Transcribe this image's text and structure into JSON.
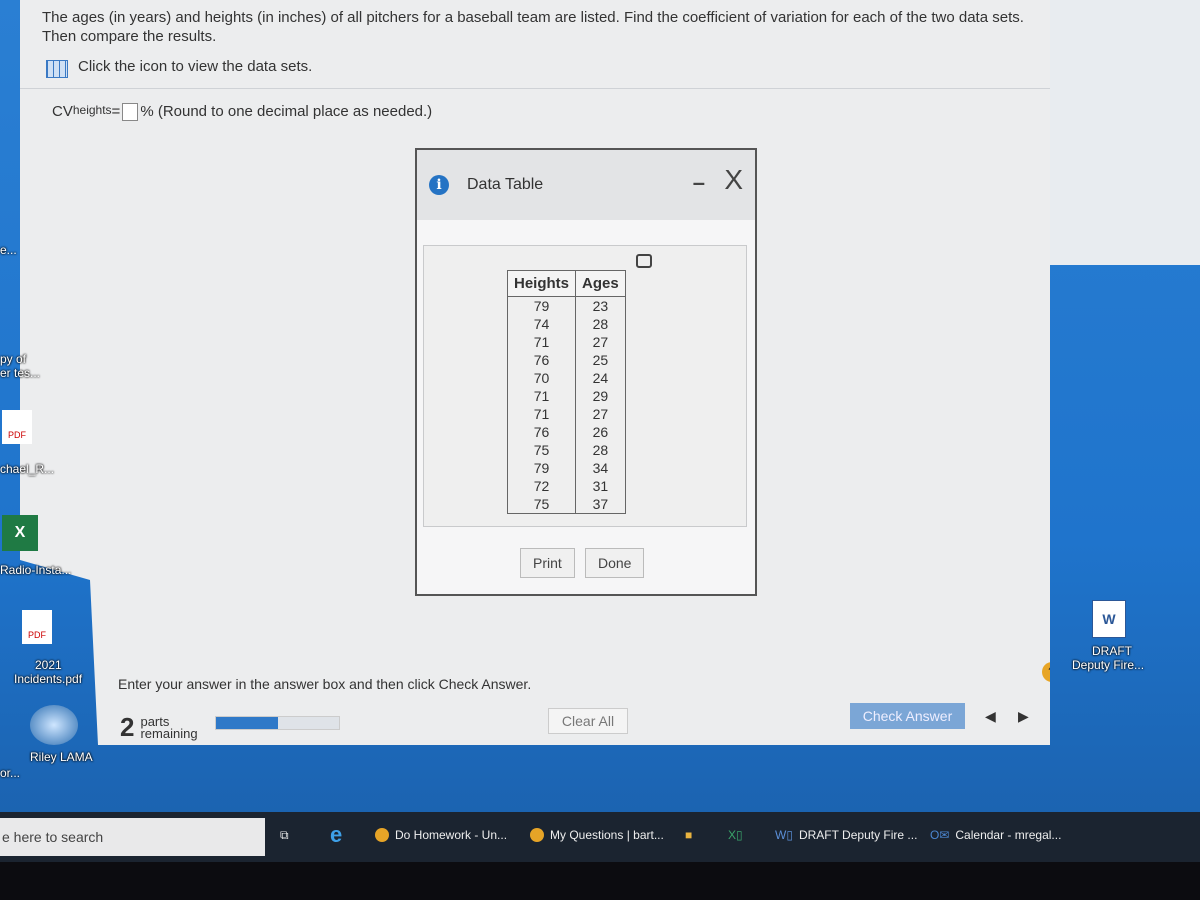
{
  "question": {
    "text": "The ages (in years) and heights (in inches) of all pitchers for a baseball team are listed. Find the coefficient of variation for each of the two data sets. Then compare the results.",
    "click_icon_text": "Click the icon to view the data sets.",
    "cv_label": "CV",
    "cv_sub": "heights",
    "cv_eq": " = ",
    "answer_value": "",
    "round_note": "% (Round to one decimal place as needed.)"
  },
  "dialog": {
    "title": "Data Table",
    "info_icon": "i",
    "minimize": "–",
    "close": "X",
    "columns": [
      "Heights",
      "Ages"
    ],
    "rows": [
      [
        "79",
        "23"
      ],
      [
        "74",
        "28"
      ],
      [
        "71",
        "27"
      ],
      [
        "76",
        "25"
      ],
      [
        "70",
        "24"
      ],
      [
        "71",
        "29"
      ],
      [
        "71",
        "27"
      ],
      [
        "76",
        "26"
      ],
      [
        "75",
        "28"
      ],
      [
        "79",
        "34"
      ],
      [
        "72",
        "31"
      ],
      [
        "75",
        "37"
      ]
    ],
    "print_label": "Print",
    "done_label": "Done"
  },
  "footer": {
    "instruction": "Enter your answer in the answer box and then click Check Answer.",
    "parts_count": "2",
    "parts_text": "parts",
    "remaining_text": "remaining",
    "progress_percent": 50,
    "clear_all": "Clear All",
    "check_answer": "Check Answer",
    "help": "?",
    "prev": "◀",
    "next": "▶"
  },
  "desktop": {
    "icons_left": [
      "e...",
      "py of",
      "er tes...",
      "PDF",
      "chael_R...",
      "Radio-Insta...",
      "PDF",
      "2021",
      "Incidents.pdf",
      "Riley LAMA",
      "or..."
    ],
    "icon_right": {
      "line1": "DRAFT",
      "line2": "Deputy Fire..."
    }
  },
  "taskbar": {
    "search_placeholder": "e here to search",
    "items": [
      "Do Homework - Un...",
      "My Questions | bart...",
      "DRAFT Deputy Fire ...",
      "Calendar - mregal..."
    ]
  },
  "colors": {
    "accent": "#2f79c8",
    "check_button": "#7ba6d6",
    "help": "#e7a526",
    "desktop": "#1f74cc"
  }
}
